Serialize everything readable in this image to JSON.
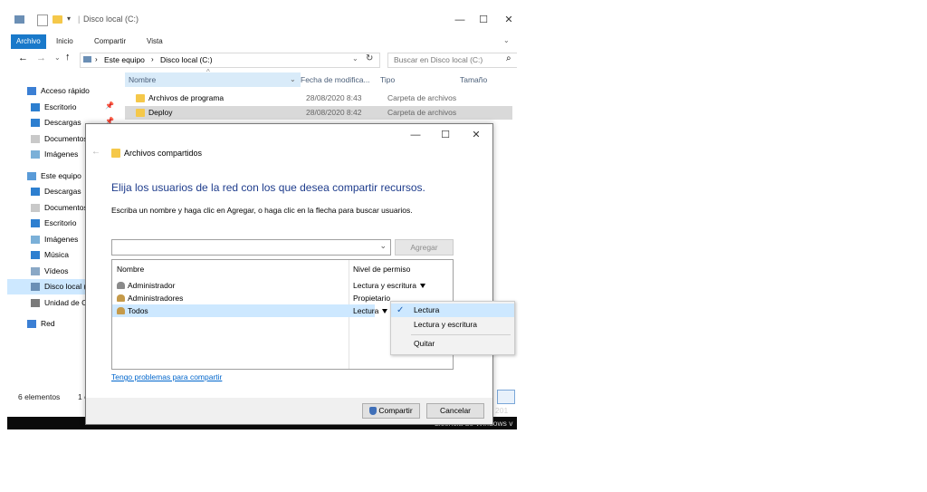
{
  "explorer": {
    "title": "Disco local (C:)",
    "window_controls": {
      "minimize": "—",
      "maximize": "☐",
      "close": "✕"
    },
    "ribbon_tabs": [
      "Archivo",
      "Inicio",
      "Compartir",
      "Vista"
    ],
    "breadcrumb": [
      "Este equipo",
      "Disco local (C:)"
    ],
    "search_placeholder": "Buscar en Disco local (C:)",
    "sidebar": [
      {
        "label": "Acceso rápido",
        "icon": "star-icon",
        "level": 0
      },
      {
        "label": "Escritorio",
        "icon": "desktop-icon",
        "level": 1
      },
      {
        "label": "Descargas",
        "icon": "download-icon",
        "level": 1
      },
      {
        "label": "Documentos",
        "icon": "document-icon",
        "level": 1
      },
      {
        "label": "Imágenes",
        "icon": "image-icon",
        "level": 1
      },
      {
        "label": "Este equipo",
        "icon": "computer-icon",
        "level": 0
      },
      {
        "label": "Descargas",
        "icon": "download-icon",
        "level": 1
      },
      {
        "label": "Documentos",
        "icon": "document-icon",
        "level": 1
      },
      {
        "label": "Escritorio",
        "icon": "desktop-icon",
        "level": 1
      },
      {
        "label": "Imágenes",
        "icon": "image-icon",
        "level": 1
      },
      {
        "label": "Música",
        "icon": "music-icon",
        "level": 1
      },
      {
        "label": "Vídeos",
        "icon": "video-icon",
        "level": 1
      },
      {
        "label": "Disco local (C:)",
        "icon": "drive-icon",
        "level": 1,
        "selected": true
      },
      {
        "label": "Unidad de CD",
        "icon": "cd-icon",
        "level": 1
      },
      {
        "label": "Red",
        "icon": "network-icon",
        "level": 0
      }
    ],
    "columns": [
      "Nombre",
      "Fecha de modifica...",
      "Tipo",
      "Tamaño"
    ],
    "files": [
      {
        "name": "Archivos de programa",
        "date": "28/08/2020 8:43",
        "type": "Carpeta de archivos"
      },
      {
        "name": "Deploy",
        "date": "28/08/2020 8:42",
        "type": "Carpeta de archivos"
      }
    ],
    "status": "6 elementos",
    "status2": "1 e",
    "watermark_line1": "rver 201",
    "watermark_line2": "Licencia de Windows v"
  },
  "dialog": {
    "title": "Archivos compartidos",
    "heading": "Elija los usuarios de la red con los que desea compartir recursos.",
    "instructions": "Escriba un nombre y haga clic en Agregar, o haga clic en la flecha para buscar usuarios.",
    "add_button": "Agregar",
    "col_name": "Nombre",
    "col_permission": "Nivel de permiso",
    "users": [
      {
        "name": "Administrador",
        "permission": "Lectura y escritura",
        "dropdown": true,
        "icon": "user-icon"
      },
      {
        "name": "Administradores",
        "permission": "Propietario",
        "dropdown": false,
        "icon": "group-icon"
      },
      {
        "name": "Todos",
        "permission": "Lectura",
        "dropdown": true,
        "icon": "group-icon",
        "selected": true
      }
    ],
    "help_link": "Tengo problemas para compartir",
    "share_button": "Compartir",
    "cancel_button": "Cancelar"
  },
  "permission_menu": {
    "items": [
      "Lectura",
      "Lectura y escritura",
      "Quitar"
    ],
    "checked": "Lectura"
  },
  "colors": {
    "accent": "#1979ca",
    "heading": "#1e3c8c",
    "selection": "#cde8ff",
    "link": "#0066cc"
  }
}
